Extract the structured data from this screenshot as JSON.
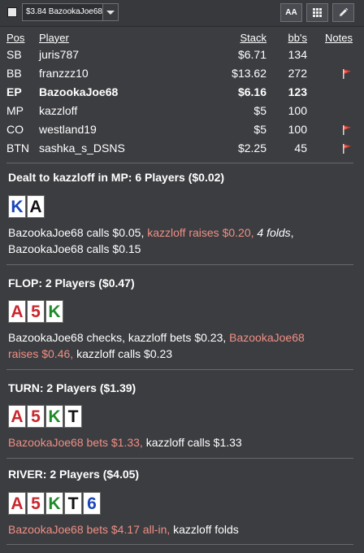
{
  "toolbar": {
    "hand_selector_value": "$3.84 BazookaJoe68",
    "font_button_label": "AA"
  },
  "table": {
    "headers": {
      "pos": "Pos",
      "player": "Player",
      "stack": "Stack",
      "bbs": "bb's",
      "notes": "Notes"
    },
    "rows": [
      {
        "pos": "SB",
        "player": "juris787",
        "stack": "$6.71",
        "bbs": "134",
        "flag": false,
        "hero": false
      },
      {
        "pos": "BB",
        "player": "franzzz10",
        "stack": "$13.62",
        "bbs": "272",
        "flag": true,
        "hero": false
      },
      {
        "pos": "EP",
        "player": "BazookaJoe68",
        "stack": "$6.16",
        "bbs": "123",
        "flag": false,
        "hero": true
      },
      {
        "pos": "MP",
        "player": "kazzloff",
        "stack": "$5",
        "bbs": "100",
        "flag": false,
        "hero": false
      },
      {
        "pos": "CO",
        "player": "westland19",
        "stack": "$5",
        "bbs": "100",
        "flag": true,
        "hero": false
      },
      {
        "pos": "BTN",
        "player": "sashka_s_DSNS",
        "stack": "$2.25",
        "bbs": "45",
        "flag": true,
        "hero": false
      }
    ]
  },
  "colors": {
    "spade": "#111111",
    "heart": "#c8282e",
    "club": "#1f8a2a",
    "diamond": "#1c46b8",
    "highlight": "#f08f84",
    "flag": "#e23b2a"
  },
  "preflop": {
    "title": "Dealt to kazzloff in MP: 6 Players ($0.02)",
    "cards": [
      {
        "rank": "K",
        "suit": "diamond"
      },
      {
        "rank": "A",
        "suit": "spade"
      }
    ],
    "line1_a": "BazookaJoe68 calls $0.05, ",
    "line1_b": "kazzloff raises $0.20, ",
    "line1_c": "4 folds",
    "line1_d": ",",
    "line2": "BazookaJoe68 calls $0.15"
  },
  "flop": {
    "title": "FLOP: 2 Players ($0.47)",
    "cards": [
      {
        "rank": "A",
        "suit": "heart"
      },
      {
        "rank": "5",
        "suit": "heart"
      },
      {
        "rank": "K",
        "suit": "club"
      }
    ],
    "line1_a": "BazookaJoe68 checks, kazzloff bets $0.23, ",
    "line1_b": "BazookaJoe68",
    "line2_a": "raises $0.46, ",
    "line2_b": "kazzloff calls $0.23"
  },
  "turn": {
    "title": "TURN: 2 Players ($1.39)",
    "cards": [
      {
        "rank": "A",
        "suit": "heart"
      },
      {
        "rank": "5",
        "suit": "heart"
      },
      {
        "rank": "K",
        "suit": "club"
      },
      {
        "rank": "T",
        "suit": "spade"
      }
    ],
    "line_a": "BazookaJoe68 bets $1.33, ",
    "line_b": "kazzloff calls $1.33"
  },
  "river": {
    "title": "RIVER: 2 Players ($4.05)",
    "cards": [
      {
        "rank": "A",
        "suit": "heart"
      },
      {
        "rank": "5",
        "suit": "heart"
      },
      {
        "rank": "K",
        "suit": "club"
      },
      {
        "rank": "T",
        "suit": "spade"
      },
      {
        "rank": "6",
        "suit": "diamond"
      }
    ],
    "line_a": "BazookaJoe68 bets $4.17 all-in, ",
    "line_b": "kazzloff folds"
  }
}
